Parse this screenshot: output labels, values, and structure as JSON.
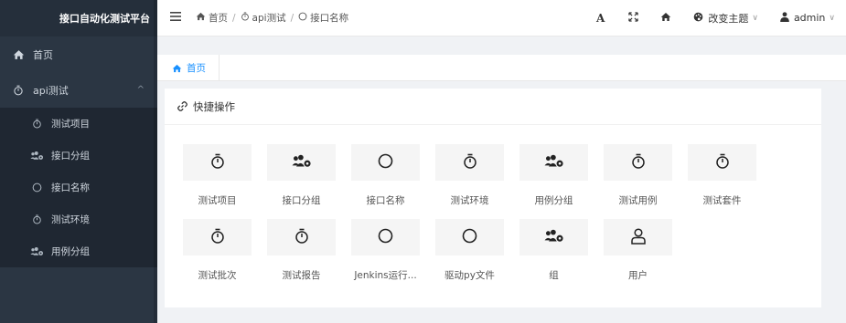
{
  "app": {
    "title": "接口自动化测试平台"
  },
  "sidebar": {
    "items": [
      {
        "label": "首页",
        "icon": "home-icon"
      },
      {
        "label": "api测试",
        "icon": "stopwatch-icon",
        "expanded": true
      }
    ],
    "submenu": [
      {
        "label": "测试项目",
        "icon": "stopwatch-icon"
      },
      {
        "label": "接口分组",
        "icon": "users-cog-icon"
      },
      {
        "label": "接口名称",
        "icon": "circle-icon"
      },
      {
        "label": "测试环境",
        "icon": "stopwatch-icon"
      },
      {
        "label": "用例分组",
        "icon": "users-cog-icon"
      }
    ]
  },
  "header": {
    "breadcrumb": [
      {
        "label": "首页",
        "icon": "home-icon"
      },
      {
        "label": "api测试",
        "icon": "stopwatch-icon"
      },
      {
        "label": "接口名称",
        "icon": "circle-icon"
      }
    ],
    "font_label": "A",
    "theme_label": "改变主题",
    "user_label": "admin"
  },
  "tabs": [
    {
      "label": "首页",
      "icon": "home-icon"
    }
  ],
  "panel": {
    "title": "快捷操作",
    "tiles": [
      {
        "label": "测试项目",
        "icon": "stopwatch-icon"
      },
      {
        "label": "接口分组",
        "icon": "users-cog-icon"
      },
      {
        "label": "接口名称",
        "icon": "circle-icon"
      },
      {
        "label": "测试环境",
        "icon": "stopwatch-icon"
      },
      {
        "label": "用例分组",
        "icon": "users-cog-icon"
      },
      {
        "label": "测试用例",
        "icon": "stopwatch-icon"
      },
      {
        "label": "测试套件",
        "icon": "stopwatch-icon"
      },
      {
        "label": "测试批次",
        "icon": "stopwatch-icon"
      },
      {
        "label": "测试报告",
        "icon": "stopwatch-icon"
      },
      {
        "label": "Jenkins运行...",
        "icon": "circle-icon"
      },
      {
        "label": "驱动py文件",
        "icon": "circle-icon"
      },
      {
        "label": "组",
        "icon": "users-cog-icon"
      },
      {
        "label": "用户",
        "icon": "user-icon"
      }
    ]
  },
  "colors": {
    "sidebar_bg": "#2b3643",
    "accent": "#1890ff"
  }
}
